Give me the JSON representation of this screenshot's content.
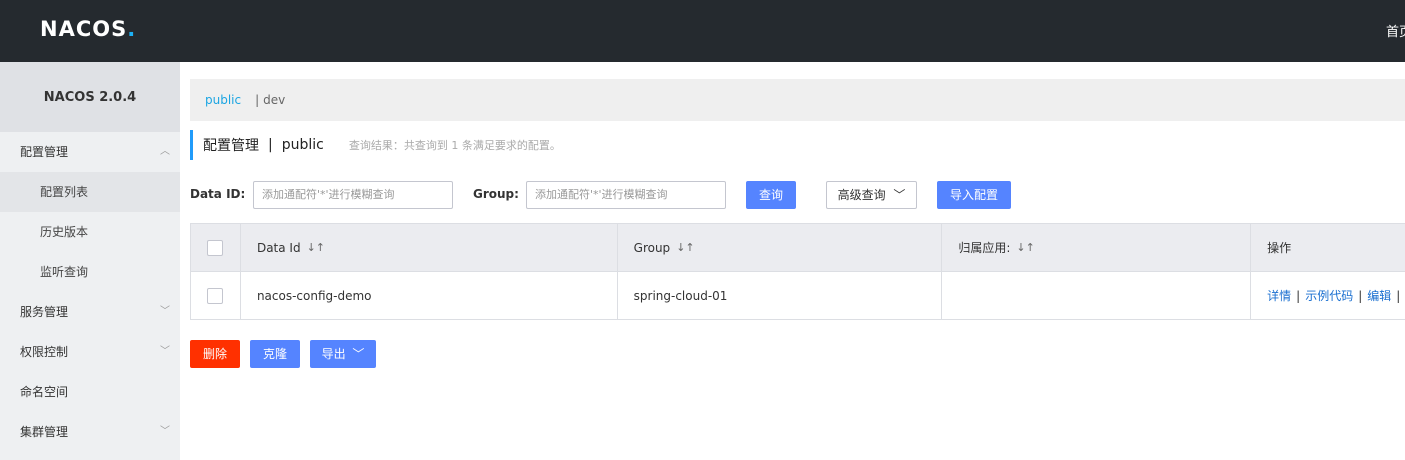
{
  "header": {
    "logo_main": "NAC",
    "logo_co": "OS",
    "logo_dot": ".",
    "nav_item": "首页"
  },
  "sidebar": {
    "version": "NACOS 2.0.4",
    "items": [
      {
        "label": "配置管理",
        "chevron": "︿"
      },
      {
        "label": "配置列表"
      },
      {
        "label": "历史版本"
      },
      {
        "label": "监听查询"
      },
      {
        "label": "服务管理",
        "chevron": "﹀"
      },
      {
        "label": "权限控制",
        "chevron": "﹀"
      },
      {
        "label": "命名空间"
      },
      {
        "label": "集群管理",
        "chevron": "﹀"
      }
    ]
  },
  "namespaces": {
    "active": "public",
    "separator": "|",
    "other": "dev"
  },
  "title": {
    "main": "配置管理",
    "separator": "|",
    "namespace": "public",
    "info": "查询结果：共查询到 1 条满足要求的配置。"
  },
  "filters": {
    "data_id_label": "Data ID:",
    "data_id_placeholder": "添加通配符'*'进行模糊查询",
    "group_label": "Group:",
    "group_placeholder": "添加通配符'*'进行模糊查询",
    "query_button": "查询",
    "advanced_button": "高级查询",
    "import_button": "导入配置"
  },
  "table": {
    "headers": [
      "Data Id",
      "Group",
      "归属应用:",
      "操作"
    ],
    "sort_icon": "↓↑",
    "rows": [
      {
        "data_id": "nacos-config-demo",
        "group": "spring-cloud-01",
        "app": "",
        "ops": [
          "详情",
          "示例代码",
          "编辑"
        ]
      }
    ]
  },
  "bulk": {
    "delete_button": "删除",
    "clone_button": "克隆",
    "export_button": "导出"
  },
  "colors": {
    "primary": "#5584ff",
    "danger": "#ff3000",
    "header_bg": "#252a2f",
    "link": "#1a6fd0"
  }
}
